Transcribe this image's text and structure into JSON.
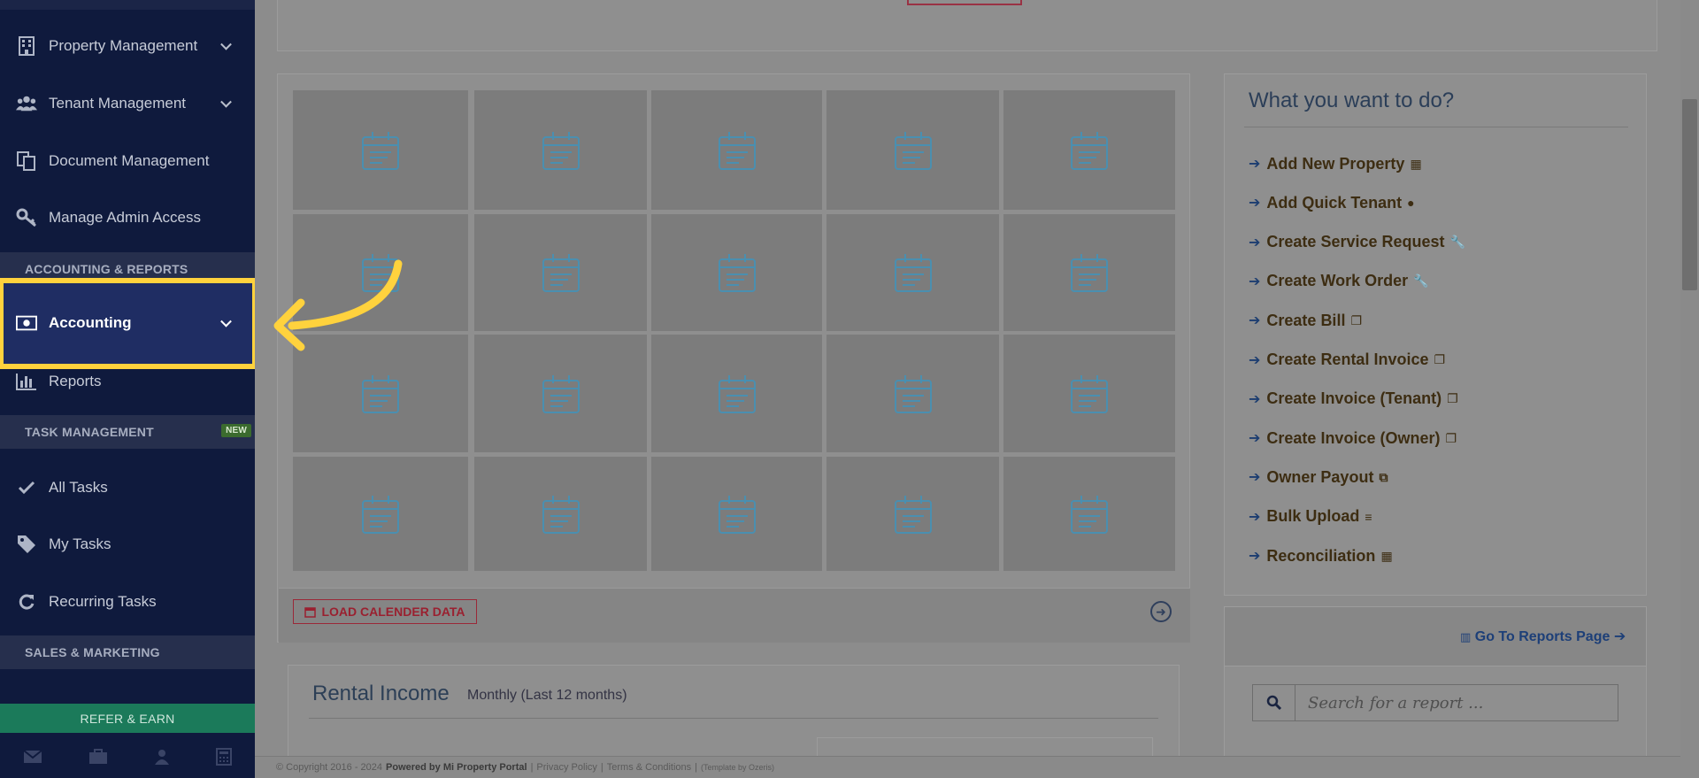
{
  "sidebar": {
    "items": [
      {
        "label": "Property Management",
        "icon": "building-icon",
        "chevron": true
      },
      {
        "label": "Tenant Management",
        "icon": "users-icon",
        "chevron": true
      },
      {
        "label": "Document Management",
        "icon": "documents-icon",
        "chevron": false
      },
      {
        "label": "Manage Admin Access",
        "icon": "key-icon",
        "chevron": false
      }
    ],
    "section_accounting": "ACCOUNTING & REPORTS",
    "accounting_label": "Accounting",
    "reports_label": "Reports",
    "section_tasks": "TASK MANAGEMENT",
    "new_badge": "NEW",
    "tasks": [
      {
        "label": "All Tasks",
        "icon": "check-icon"
      },
      {
        "label": "My Tasks",
        "icon": "tag-icon"
      },
      {
        "label": "Recurring Tasks",
        "icon": "refresh-icon"
      }
    ],
    "section_sales": "SALES & MARKETING",
    "refer_label": "REFER & EARN",
    "bottom_icons": [
      "envelope-icon",
      "briefcase-icon",
      "user-icon",
      "calculator-icon"
    ]
  },
  "calendar": {
    "load_label": "LOAD CALENDER DATA"
  },
  "rental": {
    "title": "Rental Income",
    "subtitle": "Monthly (Last 12 months)"
  },
  "quick_actions": {
    "title": "What you want to do?",
    "items": [
      {
        "label": "Add New Property",
        "icon": "building-icon"
      },
      {
        "label": "Add Quick Tenant",
        "icon": "user-icon"
      },
      {
        "label": "Create Service Request",
        "icon": "wrench-icon"
      },
      {
        "label": "Create Work Order",
        "icon": "wrench-icon"
      },
      {
        "label": "Create Bill",
        "icon": "copy-icon"
      },
      {
        "label": "Create Rental Invoice",
        "icon": "copy-icon"
      },
      {
        "label": "Create Invoice (Tenant)",
        "icon": "copy-icon"
      },
      {
        "label": "Create Invoice (Owner)",
        "icon": "copy-icon"
      },
      {
        "label": "Owner Payout",
        "icon": "clone-icon"
      },
      {
        "label": "Bulk Upload",
        "icon": "database-icon"
      },
      {
        "label": "Reconciliation",
        "icon": "calculator-icon"
      }
    ]
  },
  "reports": {
    "link_label": "Go To Reports Page",
    "search_placeholder": "Search for a report ..."
  },
  "footer": {
    "copyright": "© Copyright 2016 - 2024",
    "powered": "Powered by Mi Property Portal",
    "privacy": "Privacy Policy",
    "terms": "Terms & Conditions",
    "template": "(Template by Ozeris)"
  },
  "colors": {
    "sidebar_bg": "#0f1a3d",
    "highlight": "#ffd23d",
    "refer_bg": "#1b7a5a"
  }
}
